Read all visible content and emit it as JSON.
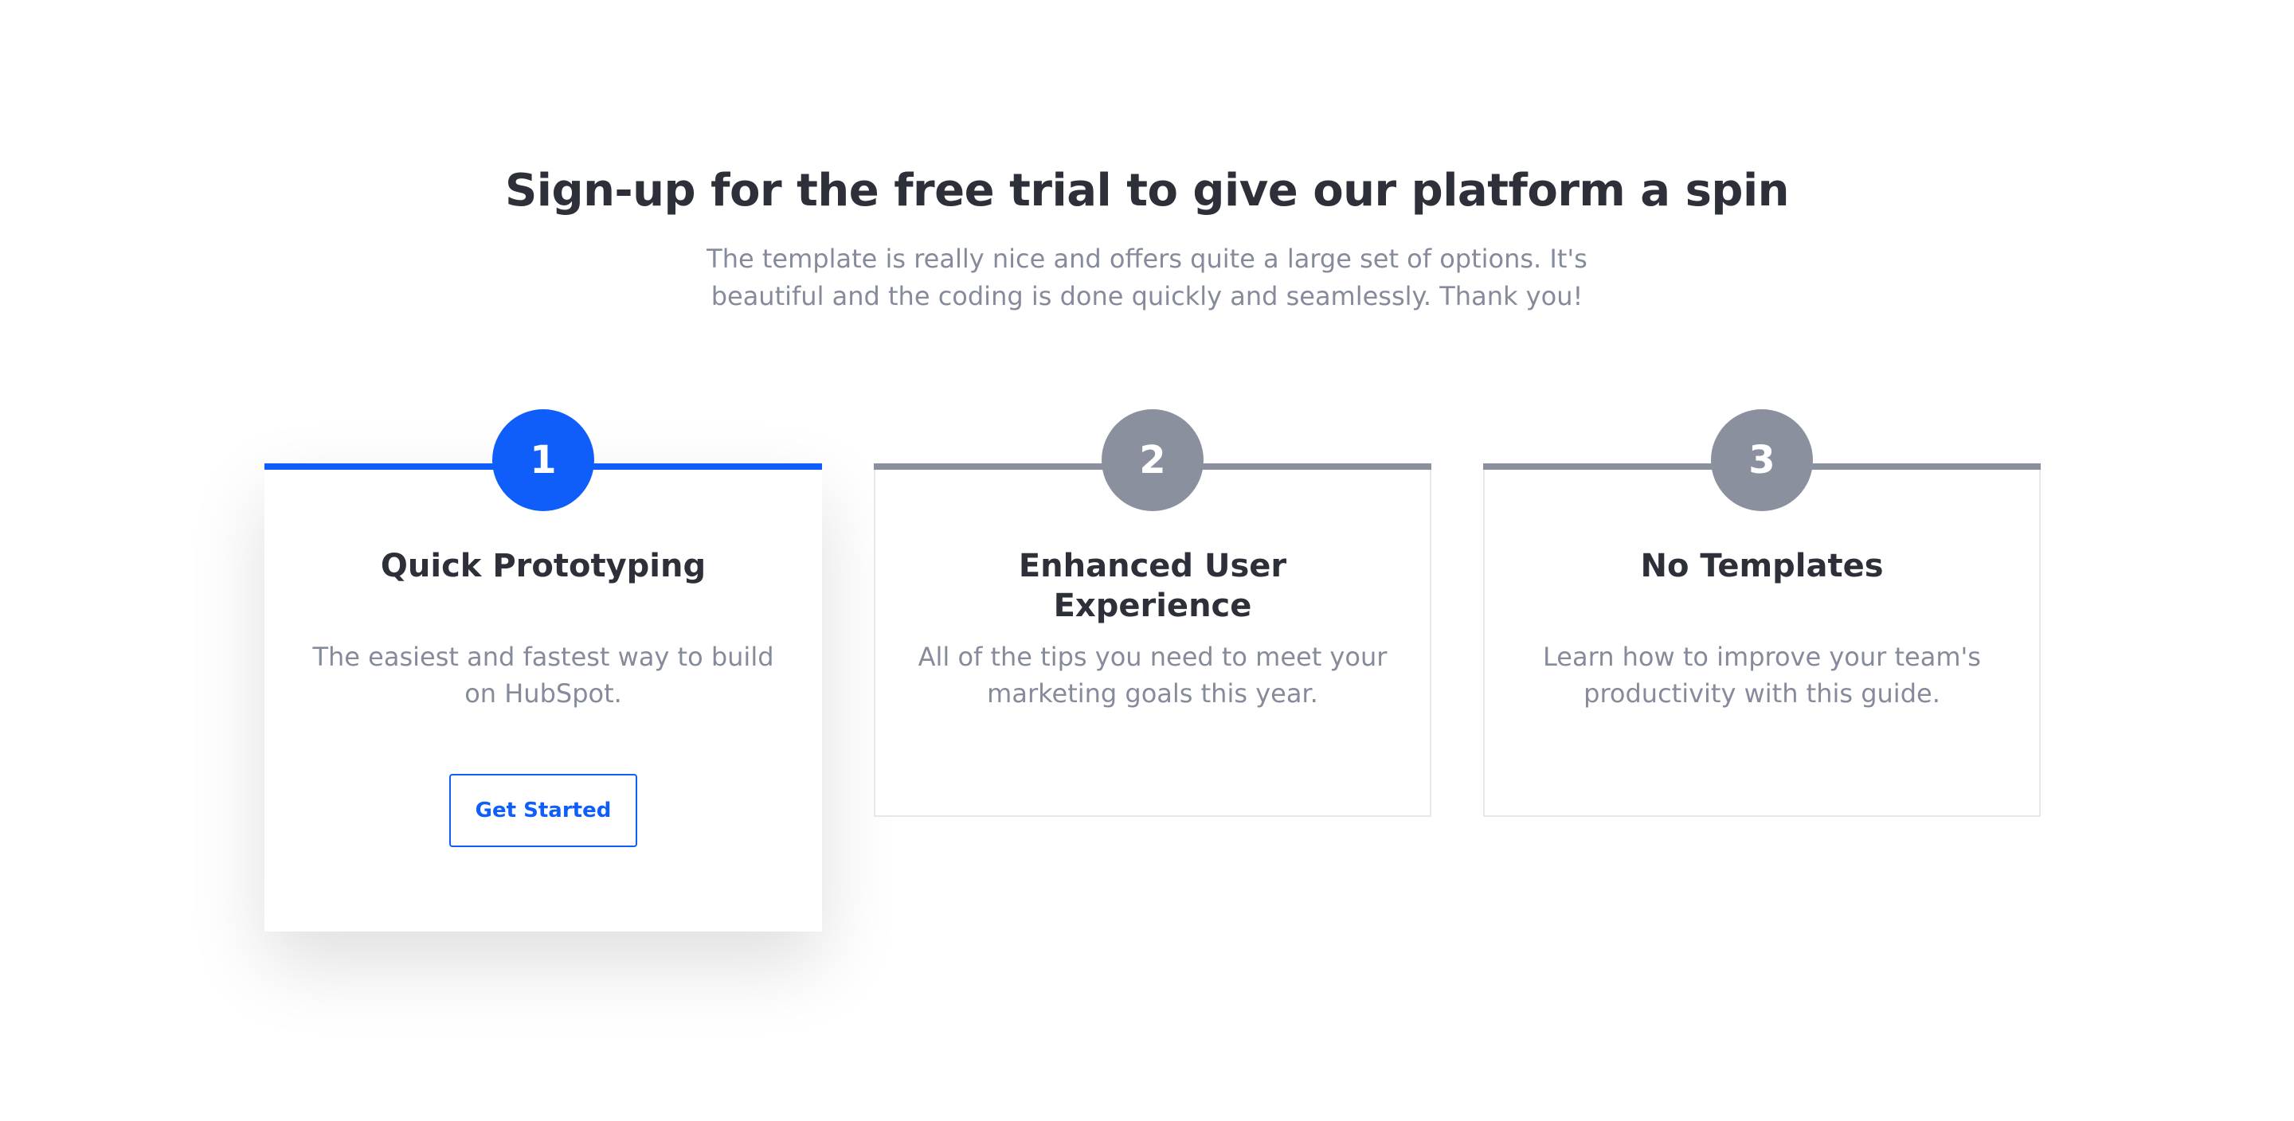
{
  "header": {
    "title": "Sign-up for the free trial to give our platform a spin",
    "subtitle": "The template is really nice and offers quite a large set of options. It's beautiful and the coding is done quickly and seamlessly. Thank you!"
  },
  "colors": {
    "accent": "#0f5efa",
    "inactive": "#8b909e",
    "heading": "#2d3039",
    "body_text": "#858b9a"
  },
  "steps": [
    {
      "number": "1",
      "title": "Quick Prototyping",
      "description": "The easiest and fastest way to build on HubSpot.",
      "button_label": "Get Started",
      "active": true
    },
    {
      "number": "2",
      "title": "Enhanced User Experience",
      "description": "All of the tips you need to meet your marketing goals this year.",
      "active": false
    },
    {
      "number": "3",
      "title": "No Templates",
      "description": "Learn how to improve your team's productivity with this guide.",
      "active": false
    }
  ]
}
